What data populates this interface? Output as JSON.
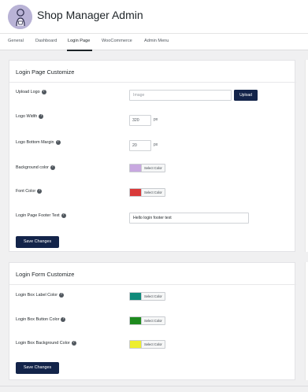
{
  "app": {
    "title": "Shop Manager Admin",
    "logo": "shopkeeper-avatar-icon"
  },
  "tabs": [
    {
      "label": "General"
    },
    {
      "label": "Dashboard"
    },
    {
      "label": "Login Page",
      "active": true
    },
    {
      "label": "WooCommerce"
    },
    {
      "label": "Admin Menu"
    }
  ],
  "login_page": {
    "title": "Login Page Customize",
    "upload_logo": {
      "label": "Upload Logo",
      "placeholder": "Image",
      "button": "Upload"
    },
    "logo_width": {
      "label": "Logo Width",
      "value": "320",
      "unit": "px"
    },
    "logo_bottom_margin": {
      "label": "Logo Bottom Margin",
      "value": "20",
      "unit": "px"
    },
    "background_color": {
      "label": "Background color",
      "color": "#c8a8e0",
      "button": "Select Color"
    },
    "font_color": {
      "label": "Font Color",
      "color": "#d93a3a",
      "button": "Select Color"
    },
    "footer_text": {
      "label": "Login Page Footer Text",
      "value": "Hello login footer text"
    },
    "save": "Save Changes"
  },
  "login_form": {
    "title": "Login Form Customize",
    "label_color": {
      "label": "Login Box Label Color",
      "color": "#0f8a7a",
      "button": "Select Color"
    },
    "button_color": {
      "label": "Login Box Button Color",
      "color": "#1e8a1e",
      "button": "Select Color"
    },
    "background_color": {
      "label": "Login Box Background Color",
      "color": "#eeee2e",
      "button": "Select Color"
    },
    "save": "Save Changes"
  },
  "colors": {
    "primary_button": "#13244a",
    "page_bg": "#f0f0f1"
  }
}
